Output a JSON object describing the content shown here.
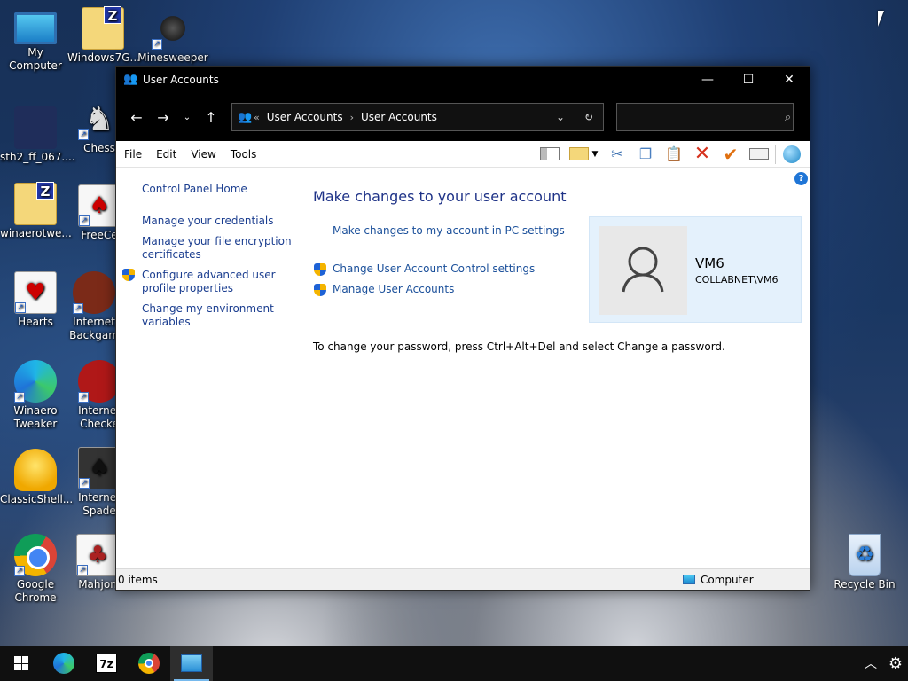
{
  "desktop": {
    "icons": [
      {
        "label": "My Computer"
      },
      {
        "label": "Windows7G..."
      },
      {
        "label": "Minesweeper"
      },
      {
        "label": "sth2_ff_067...."
      },
      {
        "label": "Chess"
      },
      {
        "label": "winaerotwe..."
      },
      {
        "label": "FreeCe"
      },
      {
        "label": "Hearts"
      },
      {
        "label": "Internet Backgam"
      },
      {
        "label": "Winaero Tweaker"
      },
      {
        "label": "Internet Checke"
      },
      {
        "label": "ClassicShell..."
      },
      {
        "label": "Internet Spade"
      },
      {
        "label": "Google Chrome"
      },
      {
        "label": "Mahjon"
      },
      {
        "label": "Recycle Bin"
      }
    ],
    "zip_letter": "Z"
  },
  "window": {
    "title": "User Accounts",
    "controls": {
      "minimize": "—",
      "maximize": "☐",
      "close": "✕"
    }
  },
  "nav": {
    "back": "←",
    "forward": "→",
    "recent": "⌄",
    "up": "↑",
    "address": {
      "prefix": "«",
      "crumbs": [
        "User Accounts",
        "User Accounts"
      ],
      "separator": "›"
    },
    "dropdown": "⌄",
    "refresh": "↻",
    "search_placeholder": "",
    "search_icon": "⌕"
  },
  "menu": [
    "File",
    "Edit",
    "View",
    "Tools"
  ],
  "toolbar_icons": [
    "preview-pane-icon",
    "select-icon",
    "cut-icon",
    "copy-icon",
    "paste-icon",
    "delete-icon",
    "check-icon",
    "properties-icon",
    "globe-icon"
  ],
  "left_pane": {
    "home": "Control Panel Home",
    "links": [
      "Manage your credentials",
      "Manage your file encryption certificates",
      "Configure advanced user profile properties",
      "Change my environment variables"
    ]
  },
  "main": {
    "heading": "Make changes to your user account",
    "pc_settings_link": "Make changes to my account in PC settings",
    "uac_link": "Change User Account Control settings",
    "manage_link": "Manage User Accounts",
    "password_note": "To change your password, press Ctrl+Alt+Del and select Change a password.",
    "help": "?"
  },
  "user": {
    "name": "VM6",
    "domain": "COLLABNET\\VM6"
  },
  "status": {
    "items": "0 items",
    "zone": "Computer"
  },
  "taskbar": {
    "apps": [
      "edge-icon",
      "7zip-icon",
      "chrome-icon",
      "control-panel-icon"
    ],
    "sevenzip_label": "7z"
  },
  "colors": {
    "link": "#1a4f9a",
    "heading": "#1e3287",
    "card_bg": "#e4f1fc",
    "titlebar": "#000000"
  }
}
